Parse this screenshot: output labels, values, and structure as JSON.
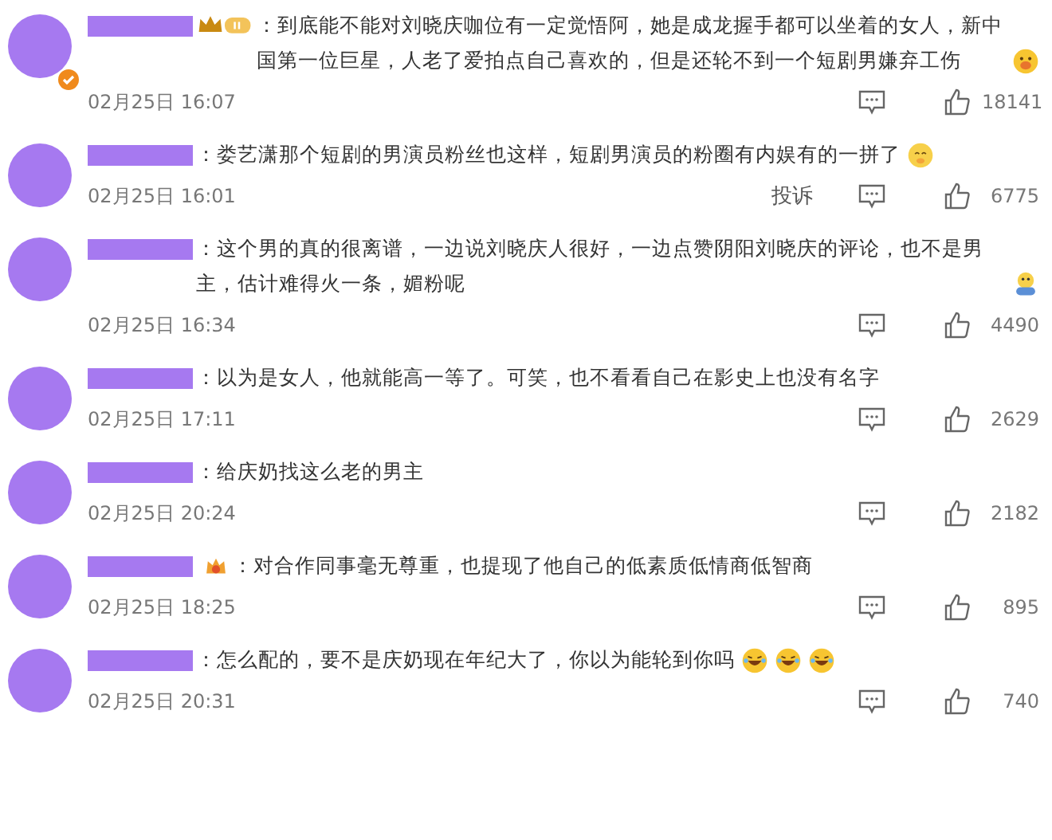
{
  "comments": [
    {
      "crown_badge": true,
      "verified": true,
      "separator": "：",
      "text": "到底能不能对刘晓庆咖位有一定觉悟阿，她是成龙握手都可以坐着的女人，新中国第一位巨星，人老了爱拍点自己喜欢的，但是还轮不到一个短剧男嫌弃工伤",
      "emojis": [
        {
          "kind": "blush"
        }
      ],
      "time": "02月25日 16:07",
      "likes": "18141"
    },
    {
      "separator": "：",
      "text": "娄艺潇那个短剧的男演员粉丝也这样，短剧男演员的粉圈有内娱有的一拼了",
      "emojis": [
        {
          "kind": "hush"
        }
      ],
      "time": "02月25日 16:01",
      "report": "投诉",
      "likes": "6775"
    },
    {
      "separator": "：",
      "text": "这个男的真的很离谱，一边说刘晓庆人很好，一边点赞阴阳刘晓庆的评论，也不是男主，估计难得火一条，媚粉呢",
      "emojis": [
        {
          "kind": "duck"
        }
      ],
      "time": "02月25日 16:34",
      "likes": "4490"
    },
    {
      "separator": "：",
      "text": "以为是女人，他就能高一等了。可笑，也不看看自己在影史上也没有名字",
      "time": "02月25日 17:11",
      "likes": "2629"
    },
    {
      "separator": "：",
      "text": "给庆奶找这么老的男主",
      "time": "02月25日 20:24",
      "likes": "2182"
    },
    {
      "fan_badge": true,
      "separator": "：",
      "text": "对合作同事毫无尊重，也提现了他自己的低素质低情商低智商",
      "time": "02月25日 18:25",
      "likes": "895"
    },
    {
      "separator": "：",
      "text": "怎么配的，要不是庆奶现在年纪大了，你以为能轮到你吗",
      "emojis": [
        {
          "kind": "laugh"
        },
        {
          "kind": "laugh"
        },
        {
          "kind": "laugh"
        }
      ],
      "time": "02月25日 20:31",
      "likes": "740"
    }
  ]
}
